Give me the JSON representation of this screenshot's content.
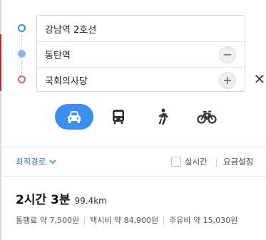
{
  "route": {
    "origin": "강남역 2호선",
    "waypoint": "동탄역",
    "destination": "국회의사당",
    "remove_waypoint_symbol": "−",
    "add_waypoint_symbol": "+",
    "close_symbol": "✕"
  },
  "transport_modes": [
    {
      "name": "car",
      "icon": "car-icon",
      "active": true
    },
    {
      "name": "bus",
      "icon": "bus-icon",
      "active": false
    },
    {
      "name": "walk",
      "icon": "walking-person-icon",
      "active": false
    },
    {
      "name": "bike",
      "icon": "bicycle-icon",
      "active": false
    }
  ],
  "options": {
    "route_type": "최적경로",
    "realtime_label": "실시간",
    "realtime_checked": false,
    "fare_settings": "요금설정"
  },
  "summary": {
    "duration": "2시간 3분",
    "distance": "99.4km",
    "toll": "통행료 약 7,500원",
    "taxi": "택시비 약 84,900원",
    "fuel": "주유비 약 15,030원"
  },
  "colors": {
    "accent": "#3d8fef",
    "link": "#2f7ad6",
    "origin_dot": "#3a8be8",
    "waypoint_dot": "#89b8ef",
    "destination_dot": "#e06464"
  }
}
